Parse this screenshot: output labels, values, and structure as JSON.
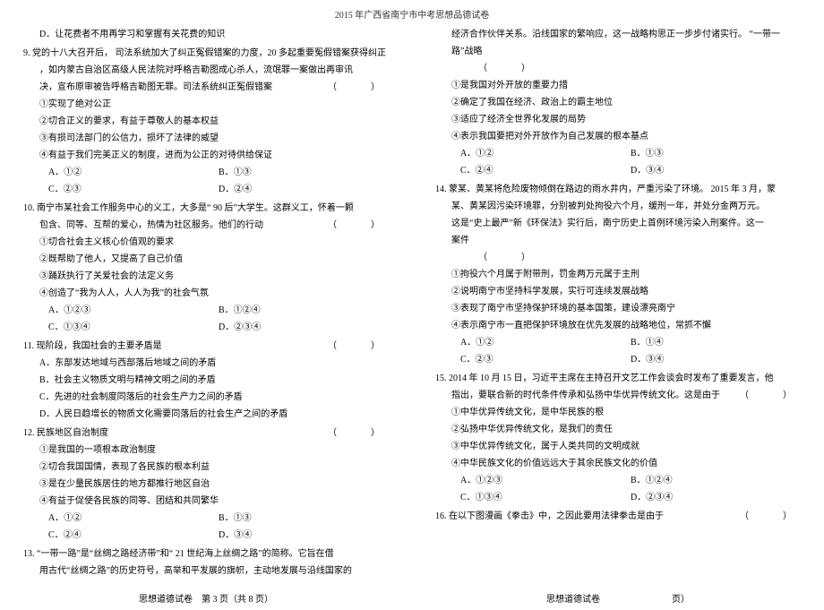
{
  "header": "2015 年广西省南宁市中考思想品德试卷",
  "left": {
    "d_option": "D．让花费者不用再学习和掌握有关花费的知识",
    "q9": {
      "stem1": "9. 党的十八大召开后，    司法系统加大了纠正冤假错案的力度，20 多起重要冤假错案获得纠正",
      "stem2": "，如内蒙古自治区高级人民法院对呼格吉勒图成心杀人，流氓罪一案做出再审讯",
      "stem3": "决，宣布原审被告呼格吉勒图无罪。司法系统纠正冤假错案",
      "paren": "（　　）",
      "o1": "①实现了绝对公正",
      "o2": "②切合正义的要求，有益于尊敬人的基本权益",
      "o3": "③有损司法部门的公信力，损坏了法律的威望",
      "o4": "④有益于我们完美正义的制度，进而为公正的对待供给保证",
      "A": "A．①②",
      "B": "B．①③",
      "C": "C．②③",
      "D": "D．②④"
    },
    "q10": {
      "stem1": "10. 南宁市某社会工作服务中心的义工，大多是“       90 后”大学生。这群义工，怀着一颗",
      "stem2": "包含、同等、互帮的爱心，热情为社区服务。他们的行动",
      "paren": "（　　）",
      "o1": "①切合社会主义核心价值观的要求",
      "o2": "②既帮助了他人，又提高了自己价值",
      "o3": "③踊跃执行了关爱社会的法定义务",
      "o4": "④创造了“我为人人，人人为我”的社会气氛",
      "A": "A．①②③",
      "B": "B．①②④",
      "C": "C．①③④",
      "D": "D．②③④"
    },
    "q11": {
      "stem": "11. 现阶段，我国社会的主要矛盾是",
      "paren": "（　　）",
      "A": "A．东部发达地域与西部落后地域之间的矛盾",
      "B": "B．社会主义物质文明与精神文明之间的矛盾",
      "C": "C．先进的社会制度同落后的社会生产力之间的矛盾",
      "D": "D．人民日趋增长的物质文化需要同落后的社会生产之间的矛盾"
    },
    "q12": {
      "stem": "12. 民族地区自治制度",
      "paren": "（　　）",
      "o1": "①是我国的一项根本政治制度",
      "o2": "②切合我国国情，表现了各民族的根本利益",
      "o3": "③是在少量民族居住的地方都推行地区自治",
      "o4": "④有益于促使各民族的同等、团结和共同繁华",
      "A": "A．①②",
      "B": "B．①③",
      "C": "C．②④",
      "D": "D．③④"
    },
    "q13": {
      "stem1": "13. “一带一路”是“丝绸之路经济带”和“        21 世纪海上丝绸之路”的简称。它旨在借",
      "stem2": "用古代“丝绸之路”的历史符号，高举和平发展的旗帜，主动地发展与沿线国家的"
    },
    "footer": "思想道德试卷　第 3 页（共 8 页）"
  },
  "right": {
    "q13cont": {
      "stem1": "经济合作伙伴关系。沿线国家的繁响应，这一战略构思正一步步付诸实行。       “一带一",
      "stem2": "路”战略",
      "paren": "（　　）",
      "o1": "①是我国对外开放的重要力措",
      "o2": "②确定了我国在经济、政治上的霸主地位",
      "o3": "③适应了经济全世界化发展的局势",
      "o4": "④表示我国要把对外开放作为自己发展的根本基点",
      "A": "A．①②",
      "B": "B．①③",
      "C": "C．②④",
      "D": "D．③④"
    },
    "q14": {
      "stem1": "14. 蒙某、黄某将危险废物倾倒在路边的雨水井内，严重污染了环境。        2015 年 3 月，蒙",
      "stem2": "某、黄某因污染环境罪，分别被判处拘役六个月，缓刑一年，并处分金两万元。",
      "stem3": "这是“史上最严”新《环保法》实行后，南宁历史上首例环境污染入刑案件。这一",
      "stem4": "案件",
      "paren": "（　　）",
      "o1": "①拘役六个月属于附带刑，罚金两万元属于主刑",
      "o2": "②说明南宁市坚持科学发展，实行可连续发展战略",
      "o3": "③表现了南宁市坚持保护环境的基本国策，建设漂亮南宁",
      "o4": "④表示南宁市一直把保护环境放在优先发展的战略地位，常抓不懈",
      "A": "A．①②",
      "B": "B．①④",
      "C": "C．②③",
      "D": "D．③④"
    },
    "q15": {
      "stem1": "15. 2014 年 10 月 15 日，习近平主席在主持召开文艺工作会谈会时发布了重要发言，他",
      "stem2": "指出，要联合新的时代条件传承和弘扬中华优异传统文化。这是由于",
      "paren": "（　　）",
      "o1": "①中华优异传统文化，是中华民族的根",
      "o2": "②弘扬中华优异传统文化，是我们的责任",
      "o3": "③中华优异传统文化，属于人类共同的文明成就",
      "o4": "④中华民族文化的价值远远大于其余民族文化的价值",
      "A": "A．①②③",
      "B": "B．①②④",
      "C": "C．①③④",
      "D": "D．②③④"
    },
    "q16": {
      "stem": "16. 在以下图漫画《拳击》中，之因此要用法律拳击是由于",
      "paren": "（　　）"
    },
    "footer": "思想道德试卷　　　　　　　　页）"
  }
}
